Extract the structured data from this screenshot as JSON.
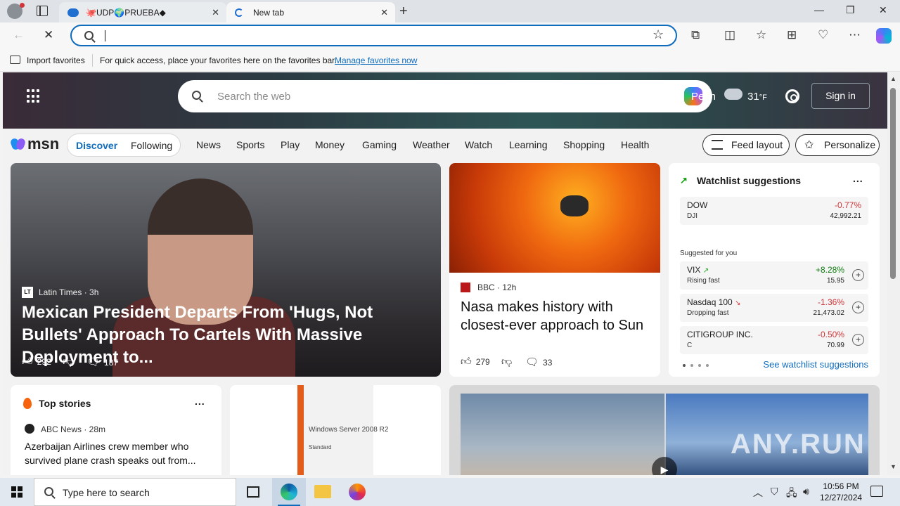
{
  "browser": {
    "tabs": [
      {
        "label": "🐙UDP🌍PRUEBA◆",
        "active": false
      },
      {
        "label": "New tab",
        "active": true
      }
    ],
    "address": {
      "value": "",
      "placeholder": ""
    }
  },
  "favorites_bar": {
    "import_label": "Import favorites",
    "hint": "For quick access, place your favorites here on the favorites bar.",
    "manage_link": "Manage favorites now"
  },
  "msn": {
    "search_placeholder": "Search the web",
    "location": "Perin",
    "temperature": "31",
    "temp_unit": "°F",
    "sign_in": "Sign in",
    "logo": "msn",
    "segments": {
      "discover": "Discover",
      "following": "Following"
    },
    "categories": [
      "News",
      "Sports",
      "Play",
      "Money",
      "Gaming",
      "Weather",
      "Watch",
      "Learning",
      "Shopping",
      "Health"
    ],
    "feed_layout": "Feed layout",
    "personalize": "Personalize"
  },
  "cards": {
    "lead": {
      "source_icon": "LT",
      "source": "Latin Times · 3h",
      "headline": "Mexican President Departs From 'Hugs, Not Bullets' Approach To Cartels With Massive Deployment to...",
      "likes": "292",
      "comments": "187"
    },
    "sun": {
      "source": "BBC · 12h",
      "headline": "Nasa makes history with closest-ever approach to Sun",
      "likes": "279",
      "comments": "33"
    },
    "watchlist": {
      "title": "Watchlist suggestions",
      "more": "...",
      "suggested_label": "Suggested for you",
      "see_all": "See watchlist suggestions",
      "rows": [
        {
          "symbol": "DOW",
          "sub": "DJI",
          "change": "-0.77%",
          "value": "42,992.21"
        },
        {
          "symbol": "VIX",
          "sub": "Rising fast",
          "change": "+8.28%",
          "value": "15.95"
        },
        {
          "symbol": "Nasdaq 100",
          "sub": "Dropping fast",
          "change": "-1.36%",
          "value": "21,473.02"
        },
        {
          "symbol": "CITIGROUP INC.",
          "sub": "C",
          "change": "-0.50%",
          "value": "70.99"
        }
      ]
    },
    "top_stories": {
      "title": "Top stories",
      "more": "...",
      "source": "ABC News · 28m",
      "headline": "Azerbaijan Airlines crew member who survived plane crash speaks out from..."
    },
    "windows_server": {
      "label": "Windows Server 2008 R2",
      "edition": "Standard"
    },
    "video": {
      "watermark": "ANY.RUN"
    }
  },
  "taskbar": {
    "search_placeholder": "Type here to search",
    "time": "10:56 PM",
    "date": "12/27/2024"
  },
  "colors": {
    "accent": "#0f6cbd",
    "negative": "#d13438",
    "positive": "#107c10"
  }
}
